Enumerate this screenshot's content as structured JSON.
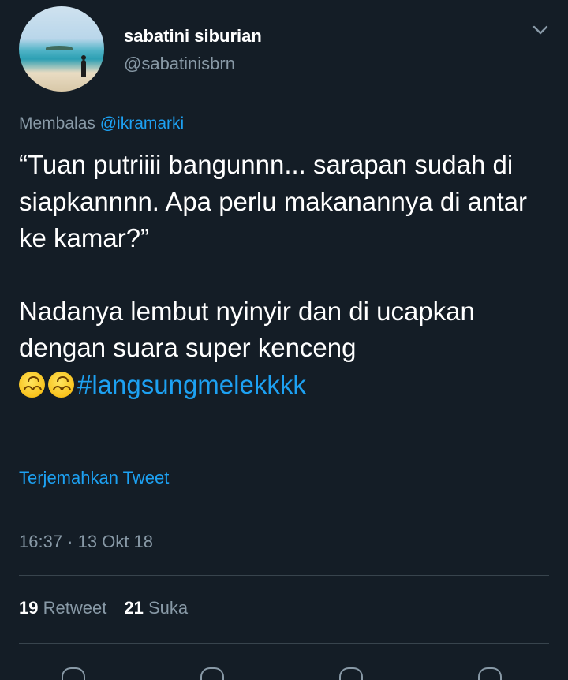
{
  "author": {
    "name": "sabatini siburian",
    "handle": "@sabatinisbrn"
  },
  "reply": {
    "prefix": "Membalas",
    "mention": "@ikramarki"
  },
  "tweet": {
    "paragraph1": "“Tuan putriiii bangunnn... sarapan sudah di siapkannnn. Apa perlu makanannya di antar ke kamar?”",
    "paragraph2": "Nadanya lembut nyinyir dan di ucapkan dengan suara  super kenceng",
    "emoji_icon": "upside-down-face-icon",
    "hashtag": "#langsungmelekkkk"
  },
  "translate_label": "Terjemahkan Tweet",
  "timestamp": "16:37 · 13 Okt 18",
  "stats": {
    "retweet_count": "19",
    "retweet_label": "Retweet",
    "like_count": "21",
    "like_label": "Suka"
  },
  "colors": {
    "background": "#141d26",
    "accent": "#1da1f2",
    "muted": "#8899a6"
  }
}
